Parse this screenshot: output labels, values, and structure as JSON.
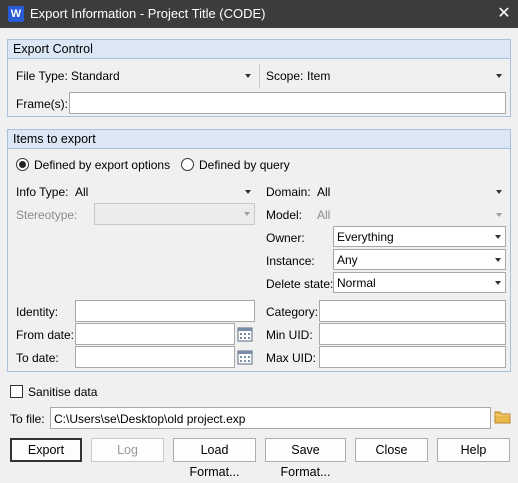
{
  "window": {
    "app_icon_letter": "W",
    "title": "Export Information - Project Title (CODE)",
    "close_glyph": "✕"
  },
  "export_control": {
    "header": "Export Control",
    "file_type_label": "File Type:",
    "file_type_value": "Standard",
    "scope_label": "Scope:",
    "scope_value": "Item",
    "frames_label": "Frame(s):",
    "frames_value": ""
  },
  "items_to_export": {
    "header": "Items to export",
    "radio_options": [
      {
        "label": "Defined by export options",
        "selected": true
      },
      {
        "label": "Defined by query",
        "selected": false
      }
    ],
    "info_type_label": "Info Type:",
    "info_type_value": "All",
    "stereotype_label": "Stereotype:",
    "stereotype_value": "",
    "domain_label": "Domain:",
    "domain_value": "All",
    "model_label": "Model:",
    "model_value": "All",
    "owner_label": "Owner:",
    "owner_value": "Everything",
    "instance_label": "Instance:",
    "instance_value": "Any",
    "delete_state_label": "Delete state:",
    "delete_state_value": "Normal",
    "identity_label": "Identity:",
    "identity_value": "",
    "from_date_label": "From date:",
    "from_date_value": "",
    "to_date_label": "To date:",
    "to_date_value": "",
    "category_label": "Category:",
    "category_value": "",
    "min_uid_label": "Min UID:",
    "min_uid_value": "",
    "max_uid_label": "Max UID:",
    "max_uid_value": ""
  },
  "sanitise": {
    "label": "Sanitise data",
    "checked": false
  },
  "to_file": {
    "label": "To file:",
    "value": "C:\\Users\\se\\Desktop\\old project.exp"
  },
  "buttons": {
    "export": "Export",
    "log": "Log",
    "load_format": "Load Format...",
    "save_format": "Save Format...",
    "close": "Close",
    "help": "Help"
  },
  "colors": {
    "titlebar": "#3c3c3c",
    "group_header": "#dce7f5",
    "group_border": "#a9c1de",
    "folder_icon": "#e8b84a"
  }
}
